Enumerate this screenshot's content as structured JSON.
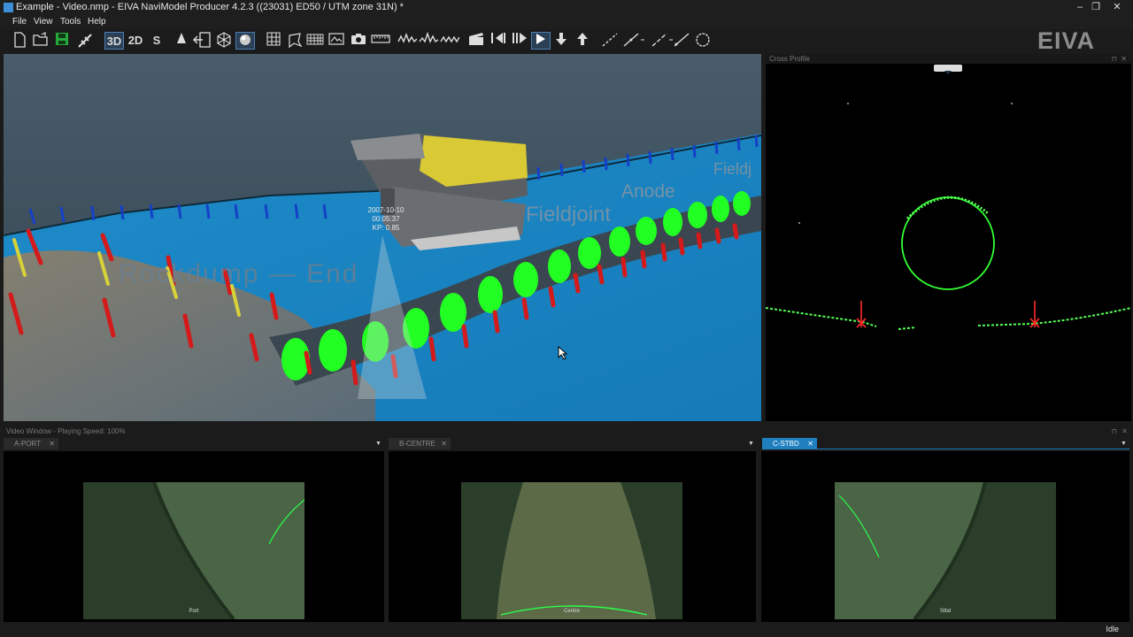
{
  "window": {
    "title": "Example - Video.nmp - EIVA NaviModel Producer 4.2.3 ((23031) ED50 / UTM zone 31N) *",
    "controls": [
      "–",
      "❐",
      "✕"
    ]
  },
  "menu": {
    "items": [
      "File",
      "View",
      "Tools",
      "Help"
    ]
  },
  "toolbar": {
    "mode_3d": "3D",
    "mode_2d": "2D",
    "mode_s": "S",
    "brand": "EIVA"
  },
  "view3d": {
    "rov_label_date": "2007-10-10",
    "rov_label_time": "00:05:37",
    "rov_label_kp": "KP: 0.85",
    "event_labels": [
      "Rockdump — End",
      "Fieldjoint",
      "Anode",
      "Fieldj"
    ]
  },
  "cross_profile": {
    "title": "Cross Profile"
  },
  "video": {
    "header": "Video Window - Playing Speed: 100%",
    "tabs": [
      {
        "label": "A-PORT",
        "close": "✕"
      },
      {
        "label": "B-CENTRE",
        "close": "✕"
      },
      {
        "label": "C-STBD",
        "close": "✕"
      }
    ],
    "captions": [
      "Port",
      "Centre",
      "Stbd"
    ]
  },
  "status": {
    "text": "Idle"
  },
  "colors": {
    "accent": "#1f7fbf",
    "pipe_marker": "#22ff22",
    "seabed": "#1a90d0",
    "arrow_red": "#d41a1a",
    "arrow_blue": "#1540c8",
    "arrow_yellow": "#d8d23a"
  }
}
